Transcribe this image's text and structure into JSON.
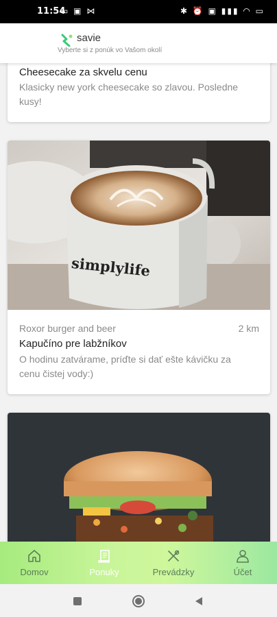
{
  "status_bar": {
    "time": "11:54",
    "left_icons": "▭ ▣ ⋈",
    "right_icons": "✱ ⏰ ▣ ▮▮▮ ◠ ▭"
  },
  "header": {
    "app_name": "savie",
    "subtitle": "Vyberte si z ponúk vo Vašom okolí"
  },
  "cards": [
    {
      "title": "Cheesecake za skvelu cenu",
      "description_line1": "Klasicky new york cheesecake so zlavou. Posledne",
      "description_line2": "kusy!"
    },
    {
      "image_icon": "coffee-cup-photo",
      "cup_text": "simplylife",
      "merchant": "Roxor burger and beer",
      "distance": "2 km",
      "title": "Kapučíno pre labžníkov",
      "description_line1": "O hodinu zatvárame, príďte si dať ešte kávičku za",
      "description_line2": "cenu čistej vody:)"
    },
    {
      "image_icon": "burger-photo"
    }
  ],
  "bottom_nav": {
    "items": [
      {
        "label": "Domov",
        "icon": "home-icon"
      },
      {
        "label": "Ponuky",
        "icon": "offers-icon",
        "active": true
      },
      {
        "label": "Prevádzky",
        "icon": "restaurant-icon"
      },
      {
        "label": "Účet",
        "icon": "account-icon"
      }
    ]
  },
  "system_nav": {
    "buttons": [
      "square",
      "circle",
      "triangle"
    ]
  },
  "colors": {
    "accent_green": "#2ecc71",
    "nav_green": "#c6f39a"
  }
}
